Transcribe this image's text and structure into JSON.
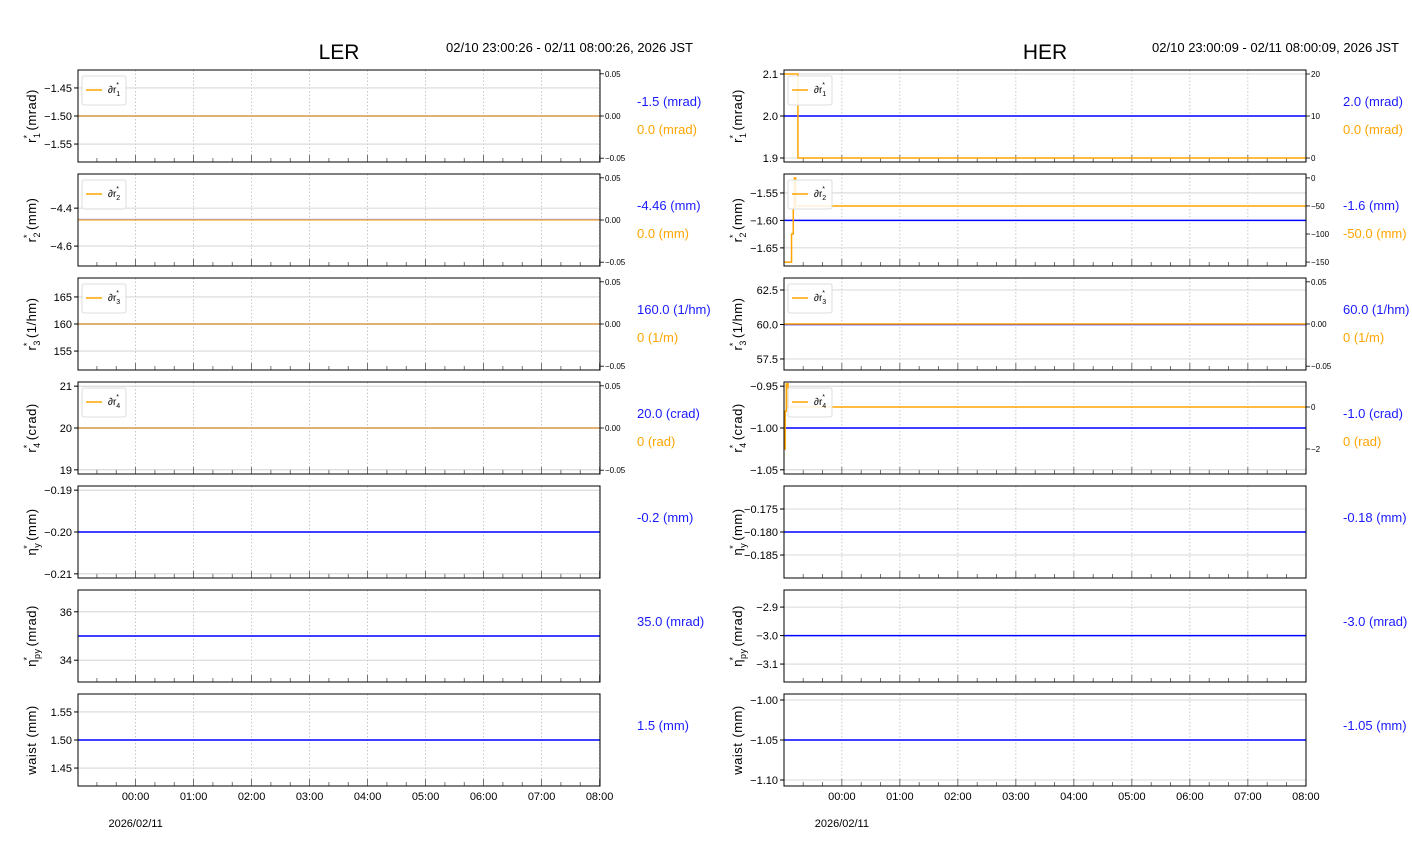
{
  "colors": {
    "main": "#0000ff",
    "delta": "#ffa500",
    "value_blue": "#1a1aff",
    "value_orange": "#ffa500",
    "grid": "#cccccc"
  },
  "chart_data": [
    {
      "type": "line",
      "title": "LER",
      "time_range": "02/10 23:00:26 - 02/11 08:00:26, 2026 JST",
      "x_unit": "hours since 02/10 23:00:26",
      "xlim": [
        0,
        9
      ],
      "xtick_labels": [
        "00:00",
        "01:00",
        "02:00",
        "03:00",
        "04:00",
        "05:00",
        "06:00",
        "07:00",
        "08:00"
      ],
      "xtick_hours": [
        0.9928,
        1.9928,
        2.9928,
        3.9928,
        4.9928,
        5.9928,
        6.9928,
        7.9928,
        8.9928
      ],
      "date_label": "2026/02/11",
      "panels": [
        {
          "sym": "r",
          "sub": "1",
          "sup": "*",
          "unit": "(mrad)",
          "ylim": [
            -1.582,
            -1.418
          ],
          "yticks": [
            -1.55,
            -1.5,
            -1.45
          ],
          "ytick_labels": [
            "−1.55",
            "−1.50",
            "−1.45"
          ],
          "value": -1.5,
          "value_label": "-1.5 (mrad)",
          "delta": {
            "legend": "∂r",
            "sub": "1",
            "sup": "*",
            "ylim": [
              -0.0545,
              0.0545
            ],
            "yticks": [
              -0.05,
              0,
              0.05
            ],
            "ytick_labels": [
              "−0.05",
              "0.00",
              "0.05"
            ],
            "points": [
              [
                0,
                0
              ],
              [
                9,
                0
              ]
            ],
            "value_label": "0.0 (mrad)"
          }
        },
        {
          "sym": "r",
          "sub": "2",
          "sup": "*",
          "unit": "(mm)",
          "ylim": [
            -4.705,
            -4.22
          ],
          "yticks": [
            -4.6,
            -4.4
          ],
          "ytick_labels": [
            "−4.6",
            "−4.4"
          ],
          "value": -4.46,
          "value_label": "-4.46 (mm)",
          "delta": {
            "legend": "∂r",
            "sub": "2",
            "sup": "*",
            "ylim": [
              -0.0545,
              0.0545
            ],
            "yticks": [
              -0.05,
              0,
              0.05
            ],
            "ytick_labels": [
              "−0.05",
              "0.00",
              "0.05"
            ],
            "points": [
              [
                0,
                0
              ],
              [
                9,
                0
              ]
            ],
            "value_label": "0.0 (mm)"
          }
        },
        {
          "sym": "r",
          "sub": "3",
          "sup": "*",
          "unit": "(1/hm)",
          "ylim": [
            151.5,
            168.5
          ],
          "yticks": [
            155,
            160,
            165
          ],
          "ytick_labels": [
            "155",
            "160",
            "165"
          ],
          "value": 160.0,
          "value_label": "160.0 (1/hm)",
          "delta": {
            "legend": "∂r",
            "sub": "3",
            "sup": "*",
            "ylim": [
              -0.0545,
              0.0545
            ],
            "yticks": [
              -0.05,
              0,
              0.05
            ],
            "ytick_labels": [
              "−0.05",
              "0.00",
              "0.05"
            ],
            "points": [
              [
                0,
                0
              ],
              [
                9,
                0
              ]
            ],
            "value_label": "0 (1/m)"
          }
        },
        {
          "sym": "r",
          "sub": "4",
          "sup": "*",
          "unit": "(crad)",
          "ylim": [
            18.9,
            21.1
          ],
          "yticks": [
            19,
            20,
            21
          ],
          "ytick_labels": [
            "19",
            "20",
            "21"
          ],
          "value": 20.0,
          "value_label": "20.0 (crad)",
          "delta": {
            "legend": "∂r",
            "sub": "4",
            "sup": "*",
            "ylim": [
              -0.0545,
              0.0545
            ],
            "yticks": [
              -0.05,
              0,
              0.05
            ],
            "ytick_labels": [
              "−0.05",
              "0.00",
              "0.05"
            ],
            "points": [
              [
                0,
                0
              ],
              [
                9,
                0
              ]
            ],
            "value_label": "0 (rad)"
          }
        },
        {
          "sym": "η",
          "sub": "y",
          "sup": "*",
          "unit": "(mm)",
          "ylim": [
            -0.211,
            -0.189
          ],
          "yticks": [
            -0.21,
            -0.2,
            -0.19
          ],
          "ytick_labels": [
            "−0.21",
            "−0.20",
            "−0.19"
          ],
          "value": -0.2,
          "value_label": "-0.2 (mm)"
        },
        {
          "sym": "η",
          "sub": "py",
          "sup": "*",
          "unit": "(mrad)",
          "ylim": [
            33.1,
            36.9
          ],
          "yticks": [
            34,
            36
          ],
          "ytick_labels": [
            "34",
            "36"
          ],
          "value": 35.0,
          "value_label": "35.0 (mrad)"
        },
        {
          "sym": "waist",
          "sub": "",
          "sup": "",
          "unit": "(mm)",
          "ylim": [
            1.418,
            1.582
          ],
          "yticks": [
            1.45,
            1.5,
            1.55
          ],
          "ytick_labels": [
            "1.45",
            "1.50",
            "1.55"
          ],
          "value": 1.5,
          "value_label": "1.5 (mm)"
        }
      ]
    },
    {
      "type": "line",
      "title": "HER",
      "time_range": "02/10 23:00:09 - 02/11 08:00:09, 2026 JST",
      "x_unit": "hours since 02/10 23:00:09",
      "xlim": [
        0,
        9
      ],
      "xtick_labels": [
        "00:00",
        "01:00",
        "02:00",
        "03:00",
        "04:00",
        "05:00",
        "06:00",
        "07:00",
        "08:00"
      ],
      "xtick_hours": [
        0.9975,
        1.9975,
        2.9975,
        3.9975,
        4.9975,
        5.9975,
        6.9975,
        7.9975,
        8.9975
      ],
      "date_label": "2026/02/11",
      "panels": [
        {
          "sym": "r",
          "sub": "1",
          "sup": "*",
          "unit": "(mrad)",
          "ylim": [
            1.8905,
            2.1095
          ],
          "yticks": [
            1.9,
            2.0,
            2.1
          ],
          "ytick_labels": [
            "1.9",
            "2.0",
            "2.1"
          ],
          "value": 2.0,
          "value_label": "2.0 (mrad)",
          "delta": {
            "legend": "∂r",
            "sub": "1",
            "sup": "*",
            "ylim": [
              -0.95,
              20.95
            ],
            "yticks": [
              0,
              10,
              20
            ],
            "ytick_labels": [
              "0",
              "10",
              "20"
            ],
            "points": [
              [
                0,
                20
              ],
              [
                0.24,
                20
              ],
              [
                0.24,
                0
              ],
              [
                9,
                0
              ]
            ],
            "value_label": "0.0 (mrad)"
          }
        },
        {
          "sym": "r",
          "sub": "2",
          "sup": "*",
          "unit": "(mm)",
          "ylim": [
            -1.683,
            -1.5155
          ],
          "yticks": [
            -1.65,
            -1.6,
            -1.55
          ],
          "ytick_labels": [
            "−1.65",
            "−1.60",
            "−1.55"
          ],
          "value": -1.6,
          "value_label": "-1.6 (mm)",
          "delta": {
            "legend": "∂r",
            "sub": "2",
            "sup": "*",
            "ylim": [
              -157,
              7
            ],
            "yticks": [
              -150,
              -100,
              -50,
              0
            ],
            "ytick_labels": [
              "−150",
              "−100",
              "−50",
              "0"
            ],
            "points": [
              [
                0,
                -150
              ],
              [
                0.13,
                -150
              ],
              [
                0.13,
                -100
              ],
              [
                0.16,
                -100
              ],
              [
                0.16,
                -55
              ],
              [
                0.18,
                -55
              ],
              [
                0.18,
                0
              ],
              [
                0.2,
                0
              ],
              [
                0.2,
                -50
              ],
              [
                9,
                -50
              ]
            ],
            "value_label": "-50.0 (mm)"
          }
        },
        {
          "sym": "r",
          "sub": "3",
          "sup": "*",
          "unit": "(1/hm)",
          "ylim": [
            56.7,
            63.37
          ],
          "yticks": [
            57.5,
            60.0,
            62.5
          ],
          "ytick_labels": [
            "57.5",
            "60.0",
            "62.5"
          ],
          "value": 60.0,
          "value_label": "60.0 (1/hm)",
          "delta": {
            "legend": "∂r",
            "sub": "3",
            "sup": "*",
            "ylim": [
              -0.0545,
              0.0545
            ],
            "yticks": [
              -0.05,
              0,
              0.05
            ],
            "ytick_labels": [
              "−0.05",
              "0.00",
              "0.05"
            ],
            "points": [
              [
                0,
                0
              ],
              [
                9,
                0
              ]
            ],
            "value_label": "0 (1/m)"
          }
        },
        {
          "sym": "r",
          "sub": "4",
          "sup": "*",
          "unit": "(crad)",
          "ylim": [
            -1.055,
            -0.945
          ],
          "yticks": [
            -1.05,
            -1.0,
            -0.95
          ],
          "ytick_labels": [
            "−1.05",
            "−1.00",
            "−0.95"
          ],
          "value": -1.0,
          "value_label": "-1.0 (crad)",
          "delta": {
            "legend": "∂r",
            "sub": "4",
            "sup": "*",
            "ylim": [
              -3.19,
              1.19
            ],
            "yticks": [
              -2,
              0
            ],
            "ytick_labels": [
              "−2",
              "0"
            ],
            "points": [
              [
                0,
                -2
              ],
              [
                0.02,
                -2
              ],
              [
                0.02,
                -0.2
              ],
              [
                0.04,
                -0.2
              ],
              [
                0.04,
                1.1
              ],
              [
                0.07,
                1.1
              ],
              [
                0.07,
                0
              ],
              [
                9,
                0
              ]
            ],
            "value_label": "0 (rad)"
          }
        },
        {
          "sym": "η",
          "sub": "y",
          "sup": "*",
          "unit": "(mm)",
          "ylim": [
            -0.19,
            -0.17
          ],
          "yticks": [
            -0.185,
            -0.18,
            -0.175
          ],
          "ytick_labels": [
            "−0.185",
            "−0.180",
            "−0.175"
          ],
          "value": -0.18,
          "value_label": "-0.18 (mm)"
        },
        {
          "sym": "η",
          "sub": "py",
          "sup": "*",
          "unit": "(mrad)",
          "ylim": [
            -3.163,
            -2.84
          ],
          "yticks": [
            -3.1,
            -3.0,
            -2.9
          ],
          "ytick_labels": [
            "−3.1",
            "−3.0",
            "−2.9"
          ],
          "value": -3.0,
          "value_label": "-3.0 (mrad)"
        },
        {
          "sym": "waist",
          "sub": "",
          "sup": "",
          "unit": "(mm)",
          "ylim": [
            -1.1075,
            -0.9925
          ],
          "yticks": [
            -1.1,
            -1.05,
            -1.0
          ],
          "ytick_labels": [
            "−1.10",
            "−1.05",
            "−1.00"
          ],
          "value": -1.05,
          "value_label": "-1.05 (mm)"
        }
      ]
    }
  ]
}
